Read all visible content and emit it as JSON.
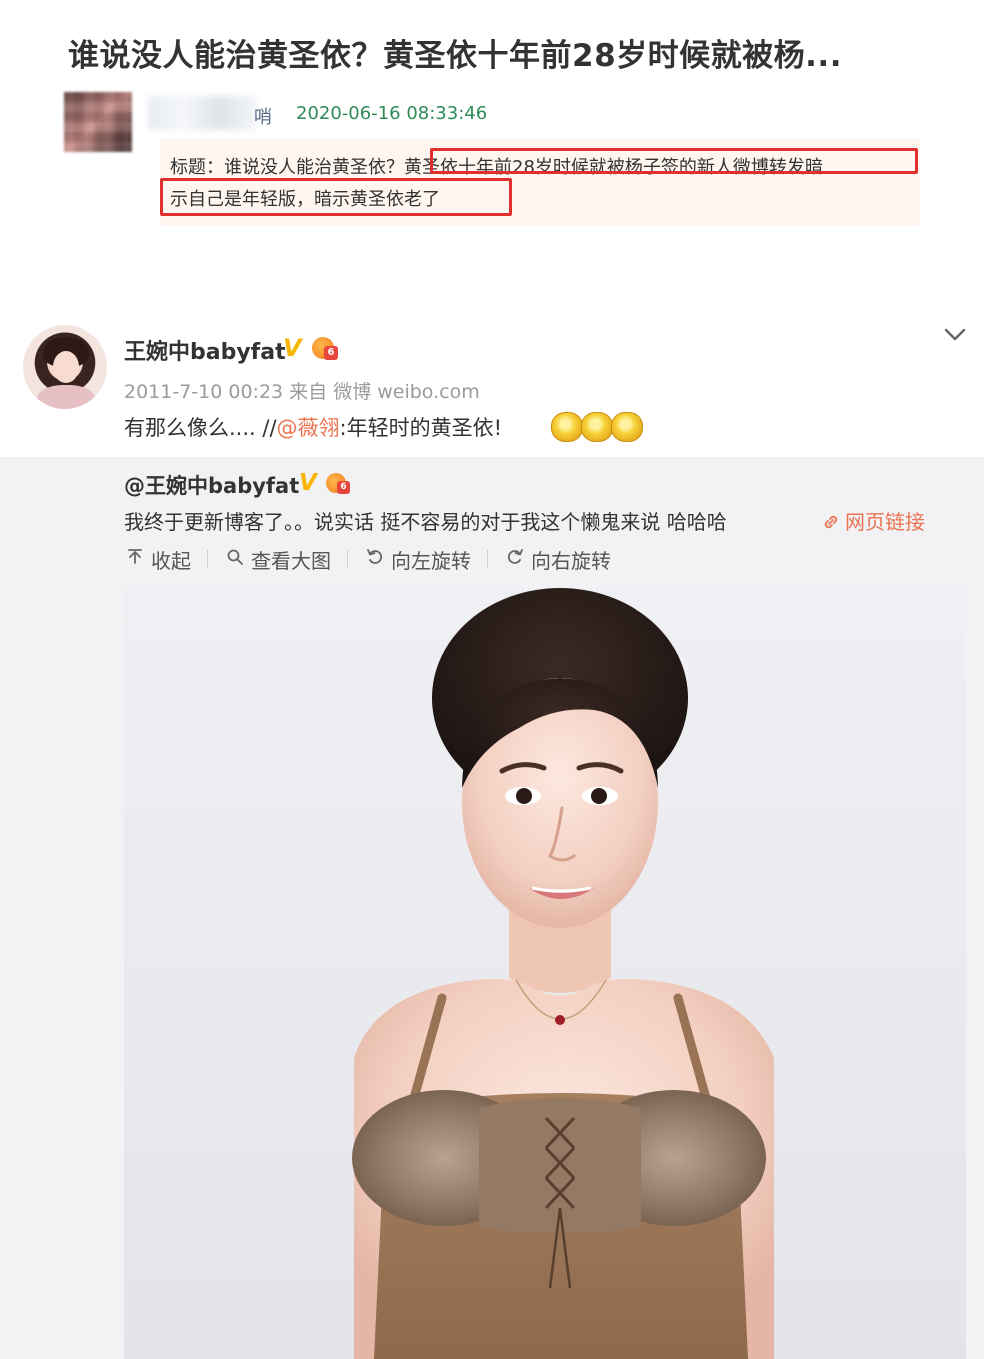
{
  "article": {
    "title": "谁说没人能治黄圣依？黄圣依十年前28岁时候就被杨...",
    "author_name_tail": "哨",
    "timestamp": "2020-06-16 08:33:46",
    "caption_line1": "标题：谁说没人能治黄圣依？黄圣依十年前28岁时候就被杨子签的新人微博转发暗",
    "caption_line2": "示自己是年轻版，暗示黄圣依老了"
  },
  "post": {
    "user_name": "王婉中babyfat",
    "verified_mark": "V",
    "meta": "2011-7-10 00:23 来自 微博 weibo.com",
    "text_prefix": "有那么像么.... //",
    "mention": "@薇翎",
    "text_suffix": ":年轻时的黄圣依!",
    "emoji_count": 3
  },
  "repost": {
    "user_handle": "@王婉中babyfat",
    "verified_mark": "V",
    "text": "我终于更新博客了。。说实话 挺不容易的对于我这个懒鬼来说 哈哈哈",
    "link_label": "网页链接",
    "toolbar": {
      "collapse": "收起",
      "view_large": "查看大图",
      "rotate_left": "向左旋转",
      "rotate_right": "向右旋转"
    }
  },
  "colors": {
    "accent_orange": "#eb7350",
    "timestamp_green": "#2e8b57",
    "highlight_red": "#e02f2f",
    "verified_gold": "#f7b500"
  }
}
